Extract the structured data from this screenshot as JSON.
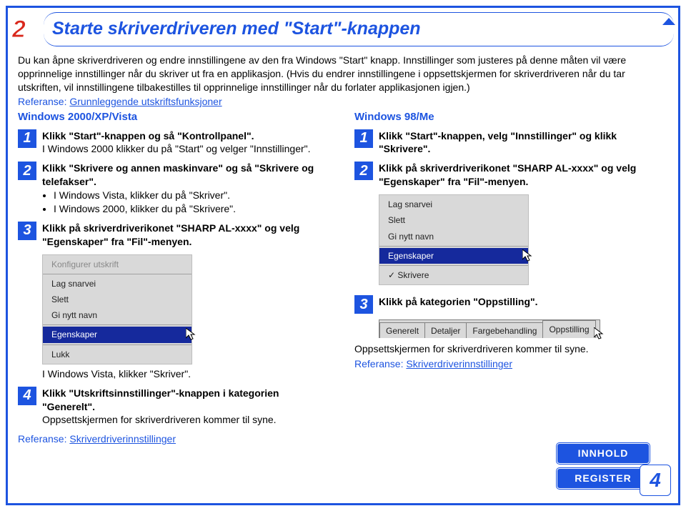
{
  "header": {
    "step_number": "2",
    "title": "Starte skriverdriveren med \"Start\"-knappen"
  },
  "intro": {
    "text": "Du kan åpne skriverdriveren og endre innstillingene av den fra Windows \"Start\" knapp. Innstillinger som justeres på denne måten vil være opprinnelige innstillinger når du skriver ut fra en applikasjon. (Hvis du endrer innstillingene i oppsettskjermen for skriverdriveren når du tar utskriften, vil innstillingene tilbakestilles til opprinnelige innstillinger når du forlater applikasjonen igjen.)"
  },
  "reference": {
    "label": "Referanse:",
    "link": "Grunnleggende utskriftsfunksjoner"
  },
  "left": {
    "title": "Windows 2000/XP/Vista",
    "steps": {
      "s1": {
        "num": "1",
        "strong": "Klikk \"Start\"-knappen og så \"Kontrollpanel\".",
        "sub": "I Windows 2000 klikker du på \"Start\" og velger \"Innstillinger\"."
      },
      "s2": {
        "num": "2",
        "strong": "Klikk \"Skrivere og annen maskinvare\" og så \"Skrivere og telefakser\".",
        "b1": "I Windows Vista, klikker du på \"Skriver\".",
        "b2": "I Windows 2000, klikker du på \"Skrivere\"."
      },
      "s3": {
        "num": "3",
        "strong": "Klikk på skriverdriverikonet \"SHARP AL-xxxx\" og velg \"Egenskaper\" fra \"Fil\"-menyen."
      },
      "menu": {
        "i1": "Konfigurer utskrift",
        "i2": "Lag snarvei",
        "i3": "Slett",
        "i4": "Gi nytt navn",
        "sel": "Egenskaper",
        "i5": "Lukk"
      },
      "note3": "I Windows Vista, klikker \"Skriver\".",
      "s4": {
        "num": "4",
        "strong": "Klikk \"Utskriftsinnstillinger\"-knappen i kategorien \"Generelt\".",
        "sub": "Oppsettskjermen for skriverdriveren kommer til syne."
      },
      "ref": {
        "label": "Referanse:",
        "link": "Skriverdriverinnstillinger"
      }
    }
  },
  "right": {
    "title": "Windows 98/Me",
    "steps": {
      "s1": {
        "num": "1",
        "strong": "Klikk \"Start\"-knappen, velg \"Innstillinger\" og klikk \"Skrivere\"."
      },
      "s2": {
        "num": "2",
        "strong": "Klikk på skriverdriverikonet \"SHARP AL-xxxx\" og velg \"Egenskaper\" fra \"Fil\"-menyen."
      },
      "menu": {
        "i1": "Lag snarvei",
        "i2": "Slett",
        "i3": "Gi nytt navn",
        "sel": "Egenskaper",
        "i4": "Skrivere"
      },
      "s3": {
        "num": "3",
        "strong": "Klikk på kategorien \"Oppstilling\"."
      },
      "tabs": {
        "t1": "Generelt",
        "t2": "Detaljer",
        "t3": "Fargebehandling",
        "t4": "Oppstilling"
      },
      "note": "Oppsettskjermen for skriverdriveren kommer til syne.",
      "ref": {
        "label": "Referanse:",
        "link": "Skriverdriverinnstillinger"
      }
    }
  },
  "buttons": {
    "innhold": "INNHOLD",
    "register": "REGISTER"
  },
  "page_number": "4"
}
